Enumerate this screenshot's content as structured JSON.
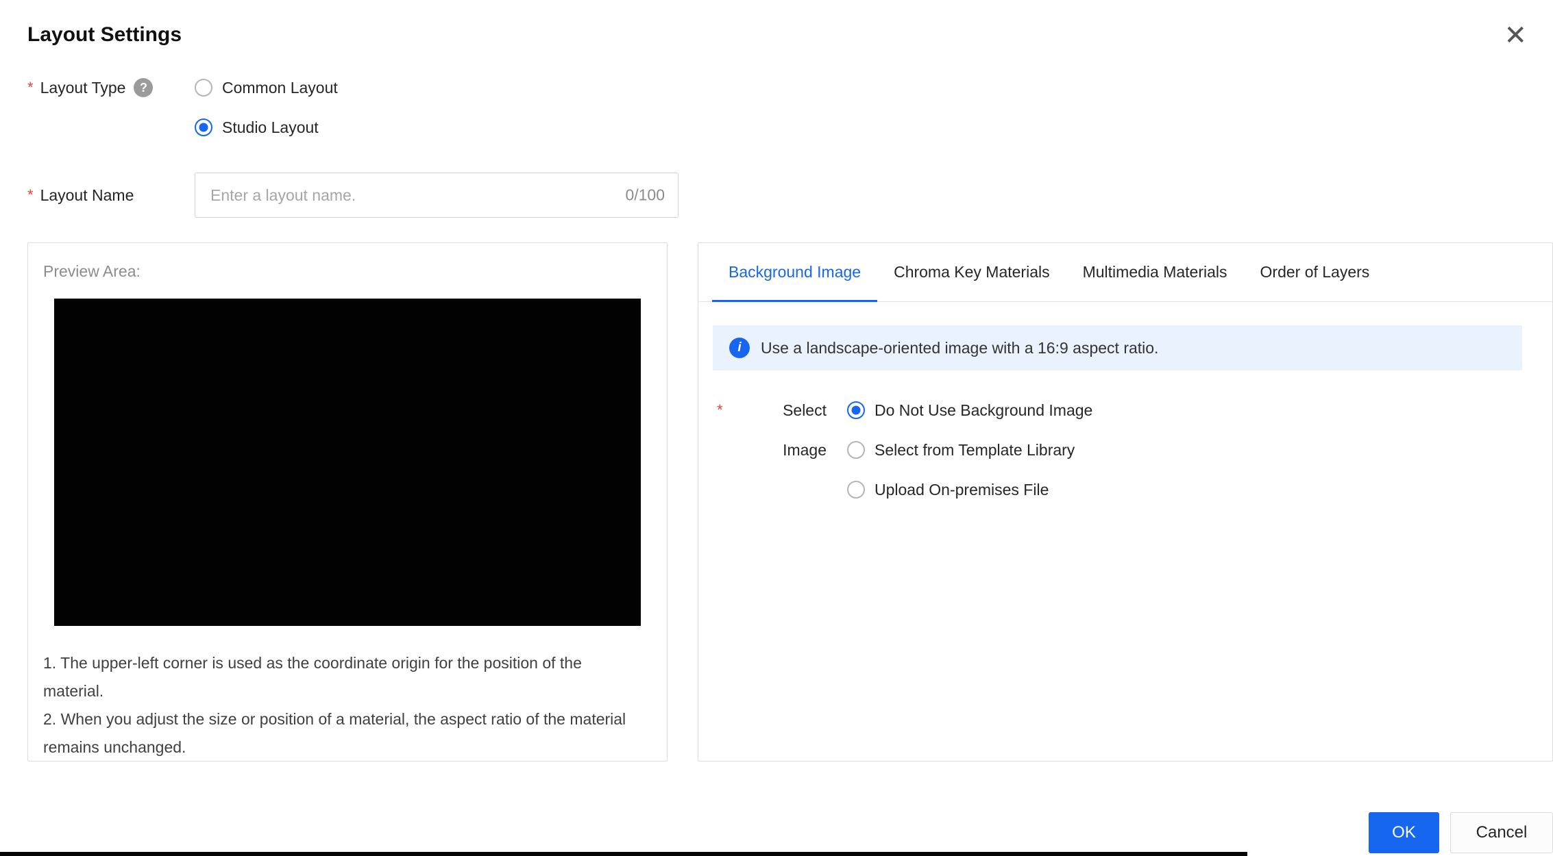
{
  "dialog": {
    "title": "Layout Settings",
    "close_icon": "✕"
  },
  "icons": {
    "help": "?",
    "info": "i"
  },
  "form": {
    "layout_type": {
      "required_mark": "*",
      "label": "Layout Type",
      "options": [
        {
          "label": "Common Layout",
          "selected": false
        },
        {
          "label": "Studio Layout",
          "selected": true
        }
      ]
    },
    "layout_name": {
      "required_mark": "*",
      "label": "Layout Name",
      "placeholder": "Enter a layout name.",
      "counter": "0/100"
    }
  },
  "preview": {
    "label": "Preview Area:",
    "notes": [
      "1. The upper-left corner is used as the coordinate origin for the position of the material.",
      "2. When you adjust the size or position of a material, the aspect ratio of the material remains unchanged."
    ]
  },
  "panel": {
    "tabs": [
      {
        "label": "Background Image",
        "active": true
      },
      {
        "label": "Chroma Key Materials",
        "active": false
      },
      {
        "label": "Multimedia Materials",
        "active": false
      },
      {
        "label": "Order of Layers",
        "active": false
      }
    ],
    "info_banner": "Use a landscape-oriented image with a 16:9 aspect ratio.",
    "select_image": {
      "required_mark": "*",
      "label_line1": "Select",
      "label_line2": "Image",
      "options": [
        {
          "label": "Do Not Use Background Image",
          "selected": true
        },
        {
          "label": "Select from Template Library",
          "selected": false
        },
        {
          "label": "Upload On-premises File",
          "selected": false
        }
      ]
    }
  },
  "footer": {
    "ok_label": "OK",
    "cancel_label": "Cancel"
  },
  "colors": {
    "accent": "#1766f0",
    "banner_bg": "#e9f2fd",
    "required": "#f04134"
  }
}
